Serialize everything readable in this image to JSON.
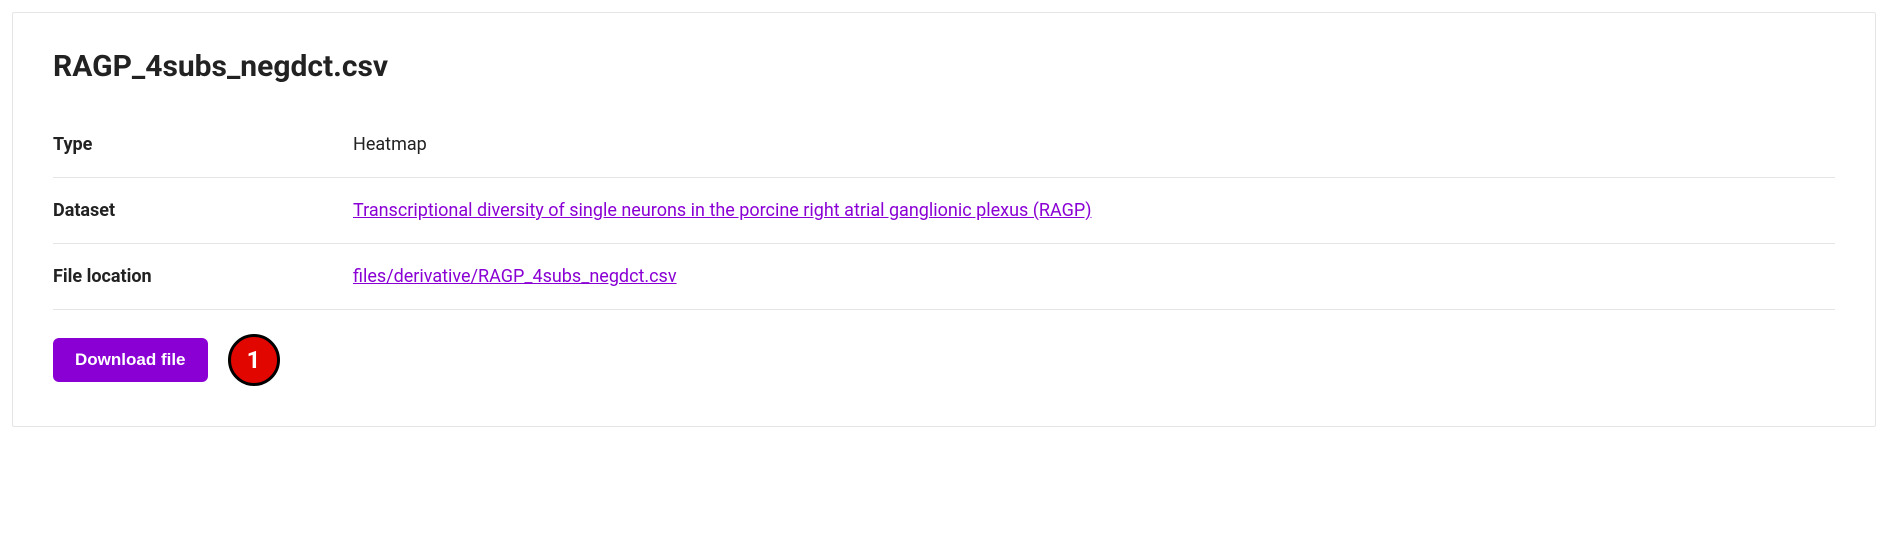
{
  "title": "RAGP_4subs_negdct.csv",
  "rows": {
    "type": {
      "label": "Type",
      "value": "Heatmap"
    },
    "dataset": {
      "label": "Dataset",
      "value": "Transcriptional diversity of single neurons in the porcine right atrial ganglionic plexus (RAGP)"
    },
    "file_location": {
      "label": "File location",
      "value": "files/derivative/RAGP_4subs_negdct.csv"
    }
  },
  "download_label": "Download file",
  "annotation": "1"
}
